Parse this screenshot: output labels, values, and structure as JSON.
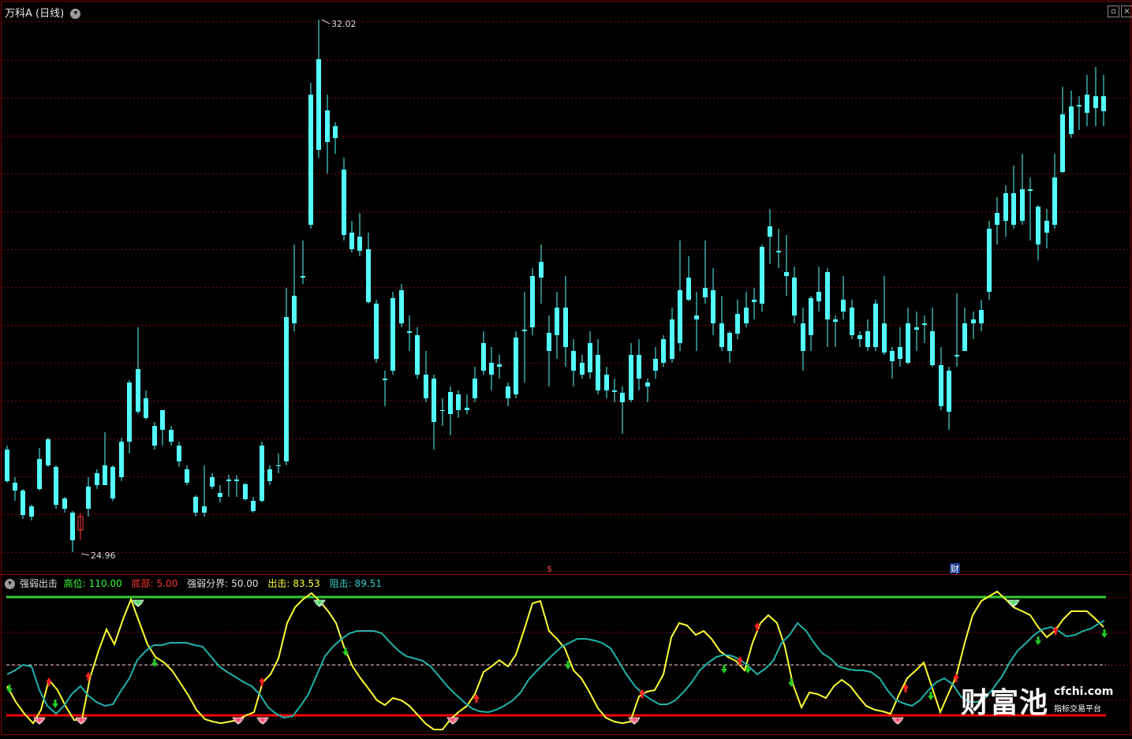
{
  "header": {
    "stock_name": "万科A",
    "period": "(日线)",
    "dropdown_icon": "chevron-down-icon",
    "max_label": "32.02",
    "min_label": "24.96",
    "event_marker_s": "$",
    "event_marker_cai": "财"
  },
  "indicator": {
    "name": "强弱出击",
    "high_label": "高位:",
    "high_value": "110.00",
    "bottom_label": "底部:",
    "bottom_value": "5.00",
    "mid_label": "强弱分界:",
    "mid_value": "50.00",
    "out_label": "出击:",
    "out_value": "83.53",
    "res_label": "阻击:",
    "res_value": "89.51"
  },
  "watermark": {
    "brand": "财富池",
    "site": "cfchi.com",
    "sub": "指标交易平台"
  },
  "colors": {
    "up": "#ff3b3b",
    "down": "#54ffff",
    "yellow": "#ffff33",
    "teal": "#20b2aa",
    "green_line": "#33cc33",
    "red_line": "#ff0000",
    "grid": "#8b0000",
    "high": "#33ff33",
    "bottom": "#ff3333",
    "out": "#ffff33",
    "res": "#33cccc"
  },
  "chart_data": {
    "type": "candlestick",
    "y_min": 24.96,
    "y_max": 32.02,
    "candles_px": "see script"
  }
}
